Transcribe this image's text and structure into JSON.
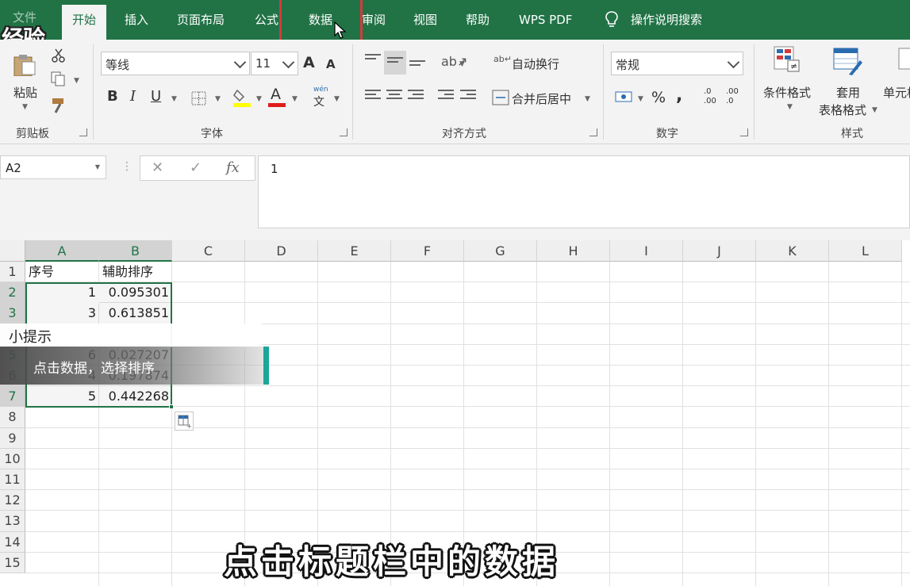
{
  "tabs": [
    {
      "label": "文件"
    },
    {
      "label": "开始"
    },
    {
      "label": "插入"
    },
    {
      "label": "页面布局"
    },
    {
      "label": "公式"
    },
    {
      "label": "数据"
    },
    {
      "label": "审阅"
    },
    {
      "label": "视图"
    },
    {
      "label": "帮助"
    },
    {
      "label": "WPS PDF"
    },
    {
      "label": "操作说明搜索"
    }
  ],
  "watermark": "经验",
  "ribbon": {
    "clipboard": {
      "paste": "粘贴",
      "group": "剪贴板"
    },
    "font": {
      "name": "等线",
      "size": "11",
      "grow": "A",
      "shrink": "A",
      "bold": "B",
      "italic": "I",
      "underline": "U",
      "font_color": "A",
      "phonetic_top": "wén",
      "phonetic_bottom": "文",
      "group": "字体"
    },
    "alignment": {
      "wrap_text": "自动换行",
      "merge_center": "合并后居中",
      "group": "对齐方式"
    },
    "number": {
      "format": "常规",
      "percent": "%",
      "comma": ",",
      "inc_decimal_top": ".0",
      "inc_decimal_bottom": ".00",
      "dec_decimal_top": ".00",
      "dec_decimal_bottom": ".0",
      "group": "数字"
    },
    "styles": {
      "conditional": "条件格式",
      "table_format_1": "套用",
      "table_format_2": "表格格式",
      "cell_styles": "单元格",
      "group": "样式"
    }
  },
  "formula_bar": {
    "name_box": "A2",
    "cancel": "✕",
    "enter": "✓",
    "fx": "fx",
    "value": "1"
  },
  "columns": [
    "A",
    "B",
    "C",
    "D",
    "E",
    "F",
    "G",
    "H",
    "I",
    "J",
    "K",
    "L"
  ],
  "rows": [
    "1",
    "2",
    "3",
    "4",
    "5",
    "6",
    "7",
    "8",
    "9",
    "10",
    "11",
    "12",
    "13",
    "14",
    "15"
  ],
  "cells": {
    "A1": "序号",
    "B1": "辅助排序",
    "A2": "1",
    "B2": "0.095301",
    "A3": "3",
    "B3": "0.613851",
    "A5": "6",
    "B5": "0.027207",
    "A6": "4",
    "B6": "0.197874",
    "A7": "5",
    "B7": "0.442268"
  },
  "tip": {
    "title": "小提示",
    "text": "点击数据，选择排序"
  },
  "subtitle": "点击标题栏中的数据",
  "colors": {
    "excel_green": "#217346",
    "ribbon_bg": "#f3f3f3",
    "highlight_red": "#d13b3b",
    "tip_accent": "#1aa79a"
  }
}
